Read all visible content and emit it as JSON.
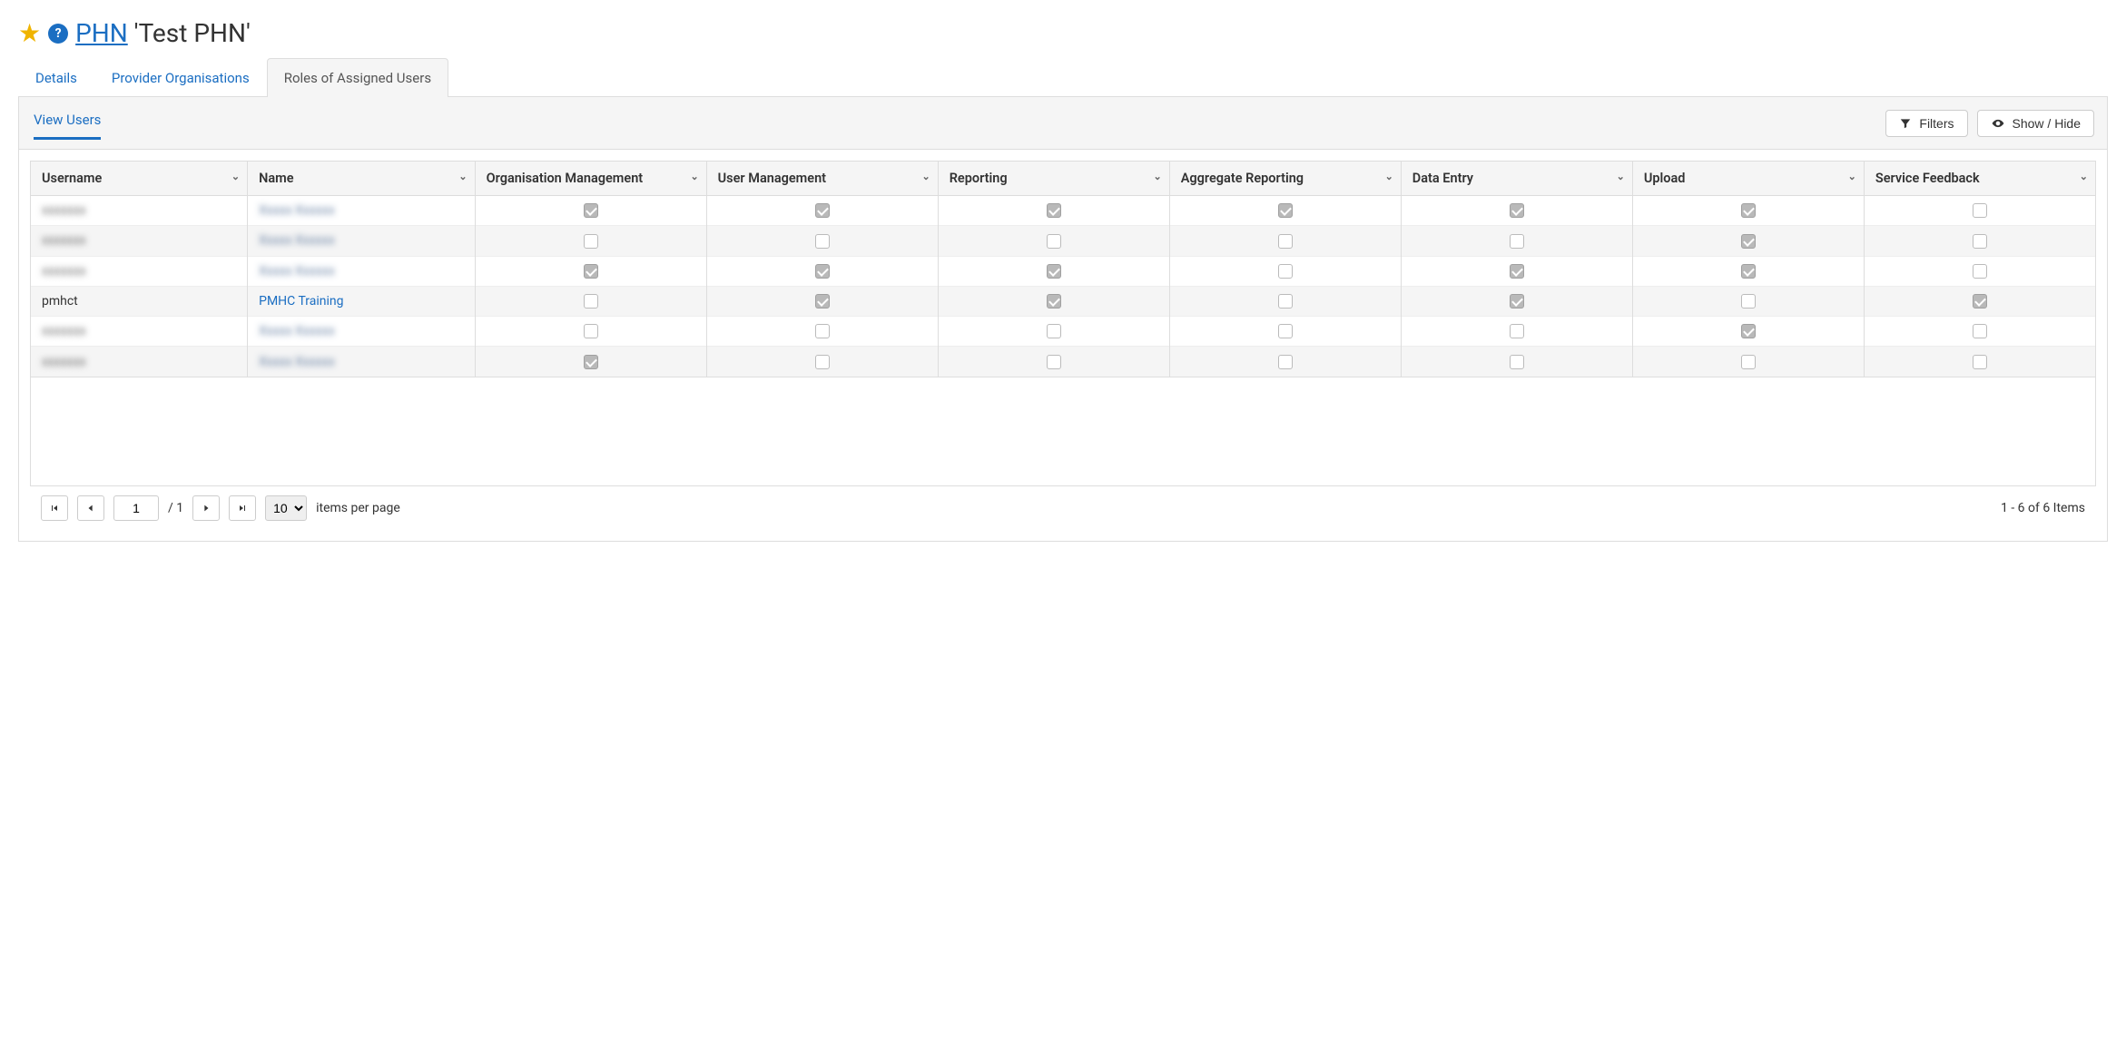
{
  "header": {
    "link_text": "PHN",
    "title_suffix": " 'Test PHN'"
  },
  "tabs": [
    {
      "label": "Details",
      "active": false
    },
    {
      "label": "Provider Organisations",
      "active": false
    },
    {
      "label": "Roles of Assigned Users",
      "active": true
    }
  ],
  "subtab": {
    "label": "View Users"
  },
  "toolbar": {
    "filters_label": "Filters",
    "showhide_label": "Show / Hide"
  },
  "columns": [
    "Username",
    "Name",
    "Organisation Management",
    "User Management",
    "Reporting",
    "Aggregate Reporting",
    "Data Entry",
    "Upload",
    "Service Feedback"
  ],
  "rows": [
    {
      "username": "redacted",
      "name": "redacted",
      "blurred": true,
      "roles": [
        true,
        true,
        true,
        true,
        true,
        true,
        false
      ]
    },
    {
      "username": "redacted",
      "name": "redacted",
      "blurred": true,
      "roles": [
        false,
        false,
        false,
        false,
        false,
        true,
        false
      ]
    },
    {
      "username": "redacted",
      "name": "redacted",
      "blurred": true,
      "roles": [
        true,
        true,
        true,
        false,
        true,
        true,
        false
      ]
    },
    {
      "username": "pmhct",
      "name": "PMHC Training",
      "blurred": false,
      "roles": [
        false,
        true,
        true,
        false,
        true,
        false,
        true
      ]
    },
    {
      "username": "redacted",
      "name": "redacted",
      "blurred": true,
      "roles": [
        false,
        false,
        false,
        false,
        false,
        true,
        false
      ]
    },
    {
      "username": "redacted",
      "name": "redacted",
      "blurred": true,
      "roles": [
        true,
        false,
        false,
        false,
        false,
        false,
        false
      ]
    }
  ],
  "pager": {
    "page": "1",
    "total_pages": "/ 1",
    "page_size": "10",
    "items_per_page_label": "items per page",
    "summary": "1 - 6 of 6 Items"
  }
}
